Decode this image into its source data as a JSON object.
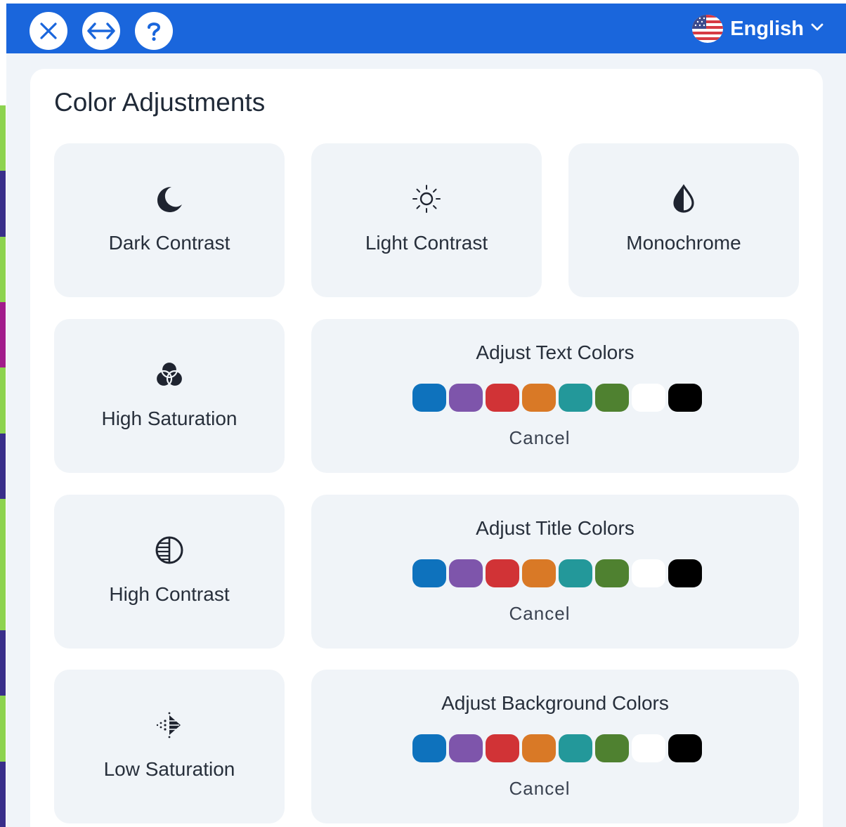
{
  "header": {
    "close_icon": "close-icon",
    "expand_icon": "horizontal-arrows-icon",
    "help_icon": "question-icon",
    "language_label": "English",
    "language_flag": "us-flag-icon",
    "background_color": "#1a66dc"
  },
  "section": {
    "title": "Color Adjustments"
  },
  "tiles": {
    "dark_contrast": {
      "label": "Dark Contrast",
      "icon": "moon-icon"
    },
    "light_contrast": {
      "label": "Light Contrast",
      "icon": "sun-icon"
    },
    "monochrome": {
      "label": "Monochrome",
      "icon": "drop-icon"
    },
    "high_saturation": {
      "label": "High Saturation",
      "icon": "circles-icon"
    },
    "high_contrast": {
      "label": "High Contrast",
      "icon": "half-circle-icon"
    },
    "low_saturation": {
      "label": "Low Saturation",
      "icon": "dotted-triangle-icon"
    }
  },
  "color_pickers": {
    "text": {
      "title": "Adjust Text Colors",
      "cancel": "Cancel"
    },
    "title": {
      "title": "Adjust Title Colors",
      "cancel": "Cancel"
    },
    "background": {
      "title": "Adjust Background Colors",
      "cancel": "Cancel"
    }
  },
  "swatch_colors": [
    "#0e72bd",
    "#7e55ab",
    "#d13336",
    "#d97926",
    "#23989a",
    "#4f8130",
    "#ffffff",
    "#000000"
  ]
}
